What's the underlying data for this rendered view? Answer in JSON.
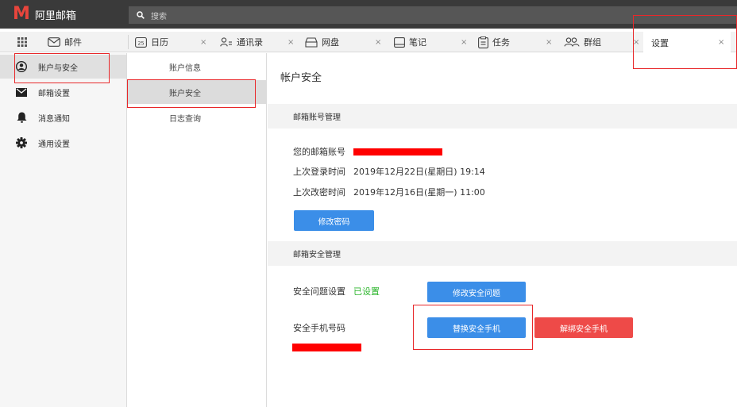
{
  "app": {
    "logo_letter": "M",
    "name": "阿里邮箱"
  },
  "search": {
    "placeholder": "搜索"
  },
  "tabs": [
    {
      "label": "邮件",
      "icon": "mail-icon"
    },
    {
      "label": "日历",
      "icon": "calendar-icon",
      "icon_text": "25",
      "close": "×"
    },
    {
      "label": "通讯录",
      "icon": "contacts-icon",
      "close": "×"
    },
    {
      "label": "网盘",
      "icon": "cloud-drive-icon",
      "close": "×"
    },
    {
      "label": "笔记",
      "icon": "note-icon",
      "close": "×"
    },
    {
      "label": "任务",
      "icon": "task-icon",
      "close": "×"
    },
    {
      "label": "群组",
      "icon": "group-icon",
      "close": "×"
    },
    {
      "label": "设置",
      "close": "×"
    }
  ],
  "sidebar": {
    "items": [
      {
        "label": "账户与安全",
        "icon": "user-shield-icon"
      },
      {
        "label": "邮箱设置",
        "icon": "envelope-icon"
      },
      {
        "label": "消息通知",
        "icon": "bell-icon"
      },
      {
        "label": "通用设置",
        "icon": "gear-icon"
      }
    ]
  },
  "subnav": {
    "items": [
      {
        "label": "账户信息"
      },
      {
        "label": "账户安全"
      },
      {
        "label": "日志查询"
      }
    ]
  },
  "main": {
    "title": "帐户安全",
    "account_section": {
      "title": "邮箱账号管理",
      "account_label": "您的邮箱账号",
      "last_login_label": "上次登录时间",
      "last_login_value": "2019年12月22日(星期日) 19:14",
      "last_pwd_label": "上次改密时间",
      "last_pwd_value": "2019年12月16日(星期一) 11:00",
      "change_pwd_button": "修改密码"
    },
    "security_section": {
      "title": "邮箱安全管理",
      "question_label": "安全问题设置",
      "question_status": "已设置",
      "modify_question_button": "修改安全问题",
      "phone_label": "安全手机号码",
      "replace_phone_button": "替换安全手机",
      "unbind_phone_button": "解绑安全手机"
    }
  },
  "colors": {
    "topbar": "#3a3a3a",
    "logo_red": "#e8453c",
    "button_blue": "#3b8ee8",
    "button_red": "#ee4a48",
    "status_green": "#2cb52c",
    "annotation_red": "#e8282a"
  }
}
